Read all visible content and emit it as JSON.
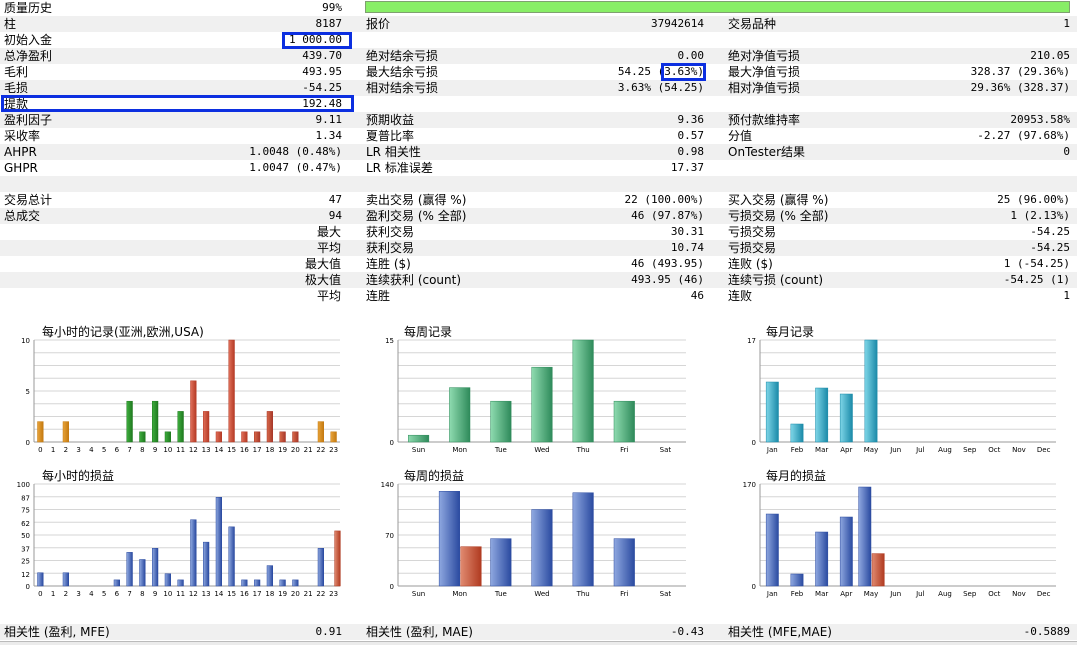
{
  "summary_rows": [
    [
      {
        "label": "质量历史",
        "value": "99%"
      },
      {
        "label": "",
        "value": ""
      },
      {
        "label": "",
        "value": ""
      }
    ],
    [
      {
        "label": "柱",
        "value": "8187"
      },
      {
        "label": "报价",
        "value": "37942614"
      },
      {
        "label": "交易品种",
        "value": "1"
      }
    ],
    [
      {
        "label": "初始入金",
        "value": "1 000.00"
      },
      {
        "label": "",
        "value": ""
      },
      {
        "label": "",
        "value": ""
      }
    ],
    [
      {
        "label": "总净盈利",
        "value": "439.70"
      },
      {
        "label": "绝对结余亏损",
        "value": "0.00"
      },
      {
        "label": "绝对净值亏损",
        "value": "210.05"
      }
    ],
    [
      {
        "label": "毛利",
        "value": "493.95"
      },
      {
        "label": "最大结余亏损",
        "value": "54.25 (3.63%)"
      },
      {
        "label": "最大净值亏损",
        "value": "328.37 (29.36%)"
      }
    ],
    [
      {
        "label": "毛损",
        "value": "-54.25"
      },
      {
        "label": "相对结余亏损",
        "value": "3.63% (54.25)"
      },
      {
        "label": "相对净值亏损",
        "value": "29.36% (328.37)"
      }
    ],
    [
      {
        "label": "提款",
        "value": "192.48"
      },
      {
        "label": "",
        "value": ""
      },
      {
        "label": "",
        "value": ""
      }
    ],
    [
      {
        "label": "盈利因子",
        "value": "9.11"
      },
      {
        "label": "预期收益",
        "value": "9.36"
      },
      {
        "label": "预付款维持率",
        "value": "20953.58%"
      }
    ],
    [
      {
        "label": "采收率",
        "value": "1.34"
      },
      {
        "label": "夏普比率",
        "value": "0.57"
      },
      {
        "label": "分值",
        "value": "-2.27 (97.68%)"
      }
    ],
    [
      {
        "label": "AHPR",
        "value": "1.0048 (0.48%)"
      },
      {
        "label": "LR 相关性",
        "value": "0.98"
      },
      {
        "label": "OnTester结果",
        "value": "0"
      }
    ],
    [
      {
        "label": "GHPR",
        "value": "1.0047 (0.47%)"
      },
      {
        "label": "LR 标准误差",
        "value": "17.37"
      },
      {
        "label": "",
        "value": ""
      }
    ],
    [
      {
        "label": "",
        "value": ""
      },
      {
        "label": "",
        "value": ""
      },
      {
        "label": "",
        "value": ""
      }
    ],
    [
      {
        "label": "交易总计",
        "value": "47"
      },
      {
        "label": "卖出交易 (赢得 %)",
        "value": "22 (100.00%)"
      },
      {
        "label": "买入交易 (赢得 %)",
        "value": "25 (96.00%)"
      }
    ],
    [
      {
        "label": "总成交",
        "value": "94"
      },
      {
        "label": "盈利交易 (% 全部)",
        "value": "46 (97.87%)"
      },
      {
        "label": "亏损交易 (% 全部)",
        "value": "1 (2.13%)"
      }
    ],
    [
      {
        "label": "最大",
        "value": ""
      },
      {
        "label": "获利交易",
        "value": "30.31"
      },
      {
        "label": "亏损交易",
        "value": "-54.25"
      }
    ],
    [
      {
        "label": "平均",
        "value": ""
      },
      {
        "label": "获利交易",
        "value": "10.74"
      },
      {
        "label": "亏损交易",
        "value": "-54.25"
      }
    ],
    [
      {
        "label": "最大值",
        "value": ""
      },
      {
        "label": "连胜 ($)",
        "value": "46 (493.95)"
      },
      {
        "label": "连败 ($)",
        "value": "1 (-54.25)"
      }
    ],
    [
      {
        "label": "极大值",
        "value": ""
      },
      {
        "label": "连续获利 (count)",
        "value": "493.95 (46)"
      },
      {
        "label": "连续亏损 (count)",
        "value": "-54.25 (1)"
      }
    ],
    [
      {
        "label": "平均",
        "value": ""
      },
      {
        "label": "连胜",
        "value": "46"
      },
      {
        "label": "连败",
        "value": "1"
      }
    ]
  ],
  "correlation_row": [
    {
      "label": "相关性 (盈利, MFE)",
      "value": "0.91"
    },
    {
      "label": "相关性 (盈利, MAE)",
      "value": "-0.43"
    },
    {
      "label": "相关性 (MFE,MAE)",
      "value": "-0.5889"
    }
  ],
  "colors": {
    "accent_box": "#0c2fe0",
    "progress": "#88ee66"
  },
  "chart_data": [
    {
      "type": "bar",
      "title": "每小时的记录(亚洲,欧洲,USA)",
      "categories": [
        "0",
        "1",
        "2",
        "3",
        "4",
        "5",
        "6",
        "7",
        "8",
        "9",
        "10",
        "11",
        "12",
        "13",
        "14",
        "15",
        "16",
        "17",
        "18",
        "19",
        "20",
        "21",
        "22",
        "23"
      ],
      "values": [
        2,
        0,
        2,
        0,
        0,
        0,
        0,
        4,
        1,
        4,
        1,
        3,
        6,
        3,
        1,
        10,
        1,
        1,
        3,
        1,
        1,
        0,
        2,
        1
      ],
      "ylim": [
        0,
        10
      ],
      "yticks": [
        "10",
        "5",
        "0"
      ],
      "grid": true
    },
    {
      "type": "bar",
      "title": "每周记录",
      "categories": [
        "Sun",
        "Mon",
        "Tue",
        "Wed",
        "Thu",
        "Fri",
        "Sat"
      ],
      "values": [
        1,
        8,
        6,
        11,
        15,
        6,
        0
      ],
      "ylim": [
        0,
        15
      ],
      "yticks": [
        "15",
        "0"
      ],
      "grid": true
    },
    {
      "type": "bar",
      "title": "每月记录",
      "categories": [
        "Jan",
        "Feb",
        "Mar",
        "Apr",
        "May",
        "Jun",
        "Jul",
        "Aug",
        "Sep",
        "Oct",
        "Nov",
        "Dec"
      ],
      "values": [
        10,
        3,
        9,
        8,
        17,
        0,
        0,
        0,
        0,
        0,
        0,
        0
      ],
      "ylim": [
        0,
        17
      ],
      "yticks": [
        "17",
        "0"
      ],
      "grid": true
    },
    {
      "type": "bar",
      "title": "每小时的损益",
      "categories": [
        "0",
        "1",
        "2",
        "3",
        "4",
        "5",
        "6",
        "7",
        "8",
        "9",
        "10",
        "11",
        "12",
        "13",
        "14",
        "15",
        "16",
        "17",
        "18",
        "19",
        "20",
        "21",
        "22",
        "23"
      ],
      "series": [
        {
          "values": [
            13,
            0,
            13,
            0,
            0,
            0,
            6,
            33,
            26,
            37,
            12,
            6,
            65,
            43,
            87,
            58,
            6,
            6,
            20,
            6,
            6,
            0,
            37,
            0
          ]
        },
        {
          "values": [
            0,
            0,
            0,
            0,
            0,
            0,
            0,
            0,
            0,
            0,
            0,
            0,
            0,
            0,
            0,
            0,
            0,
            0,
            0,
            0,
            0,
            0,
            0,
            54
          ]
        }
      ],
      "ylim": [
        0,
        100
      ],
      "yticks": [
        "100",
        "87",
        "75",
        "62",
        "50",
        "37",
        "25",
        "12",
        "0"
      ],
      "grid": true
    },
    {
      "type": "bar",
      "title": "每周的损益",
      "categories": [
        "Sun",
        "Mon",
        "Tue",
        "Wed",
        "Thu",
        "Fri",
        "Sat"
      ],
      "series": [
        {
          "values": [
            0,
            130,
            65,
            105,
            128,
            65,
            0
          ]
        },
        {
          "values": [
            0,
            54,
            0,
            0,
            0,
            0,
            0
          ]
        }
      ],
      "ylim": [
        0,
        140
      ],
      "yticks": [
        "140",
        "70",
        "0"
      ],
      "grid": true
    },
    {
      "type": "bar",
      "title": "每月的损益",
      "categories": [
        "Jan",
        "Feb",
        "Mar",
        "Apr",
        "May",
        "Jun",
        "Jul",
        "Aug",
        "Sep",
        "Oct",
        "Nov",
        "Dec"
      ],
      "series": [
        {
          "values": [
            120,
            20,
            90,
            115,
            165,
            0,
            0,
            0,
            0,
            0,
            0,
            0
          ]
        },
        {
          "values": [
            0,
            0,
            0,
            0,
            54,
            0,
            0,
            0,
            0,
            0,
            0,
            0
          ]
        }
      ],
      "ylim": [
        0,
        170
      ],
      "yticks": [
        "170",
        "0"
      ],
      "grid": true
    }
  ]
}
